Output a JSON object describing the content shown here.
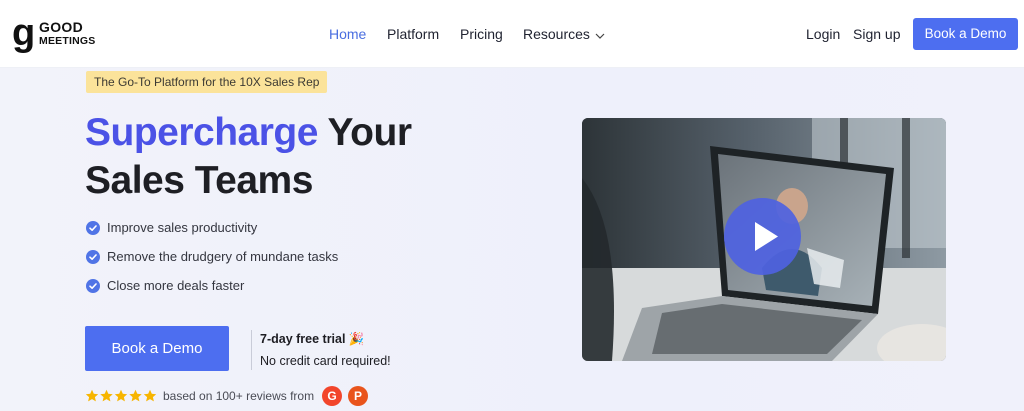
{
  "brand": {
    "logo_letter": "g",
    "logo_line1": "GOOD",
    "logo_line2": "MEETINGS"
  },
  "nav": {
    "links": [
      {
        "label": "Home",
        "active": true
      },
      {
        "label": "Platform"
      },
      {
        "label": "Pricing"
      },
      {
        "label": "Resources",
        "has_dropdown": true
      }
    ],
    "login": "Login",
    "signup": "Sign up",
    "cta": "Book a Demo"
  },
  "hero": {
    "tagline": "The Go-To Platform for the 10X Sales Rep",
    "headline_accent": "Supercharge",
    "headline_rest_1": " Your",
    "headline_line2": "Sales Teams",
    "features": [
      "Improve sales productivity",
      "Remove the drudgery of mundane tasks",
      "Close more deals faster"
    ],
    "cta": "Book a Demo",
    "trial_title": "7-day free trial 🎉",
    "trial_sub": "No credit card required!",
    "rating_stars": 5,
    "reviews_text": "based on 100+ reviews from",
    "review_badges": [
      "G",
      "P"
    ]
  },
  "video": {
    "play_icon": "play-icon"
  },
  "colors": {
    "accent": "#4d6ef0",
    "headline_accent": "#4b52e6",
    "tagline_bg": "#fbe39a",
    "star": "#f7b500",
    "g2": "#f2452b",
    "producthunt": "#e9541c"
  }
}
